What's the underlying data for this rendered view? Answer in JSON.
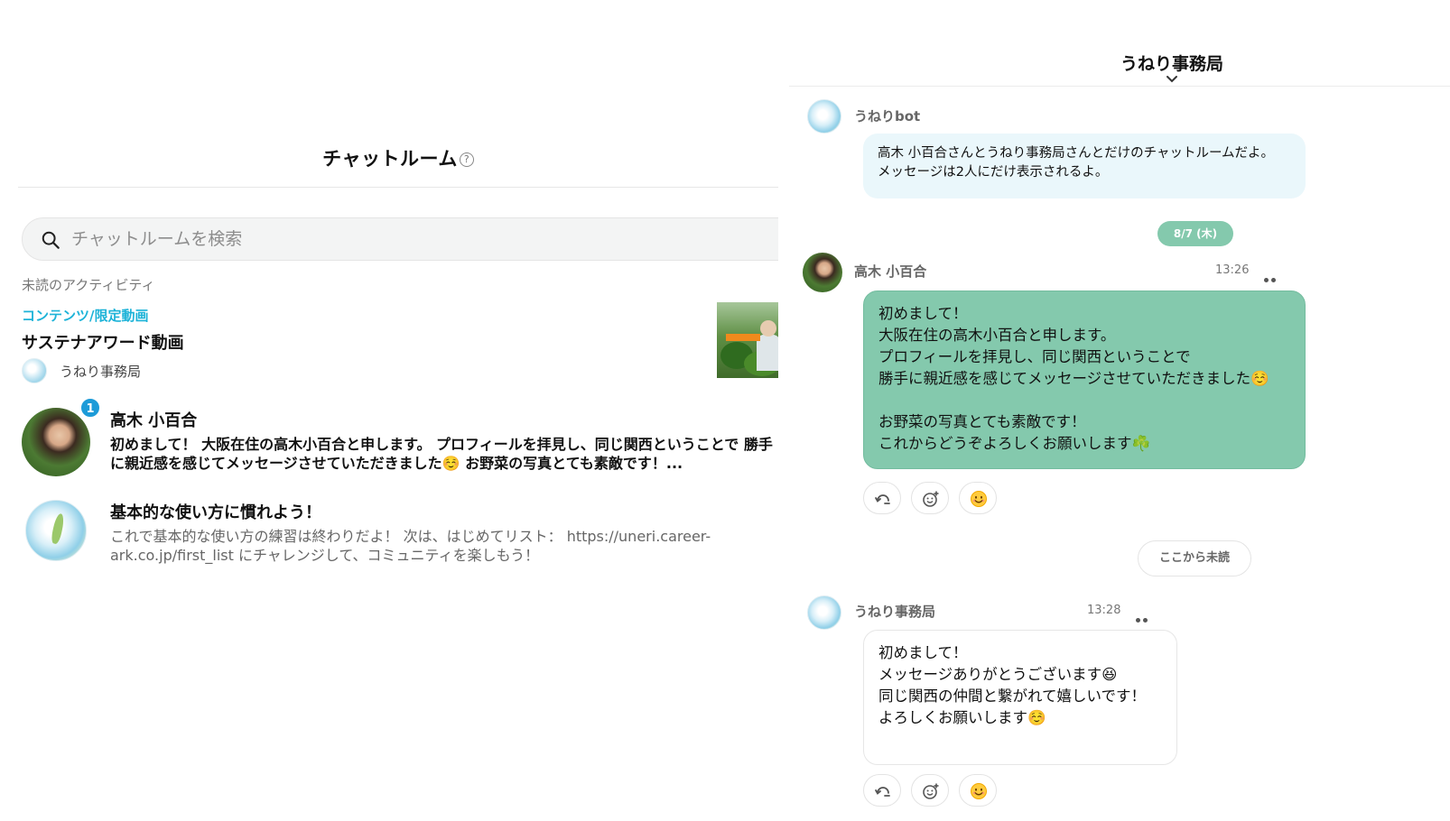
{
  "left": {
    "title": "チャットルーム",
    "help_glyph": "?",
    "search": {
      "placeholder": "チャットルームを検索"
    },
    "unread_section_label": "未読のアクティビティ",
    "content_item": {
      "category": "コンテンツ/限定動画",
      "title": "サステナアワード動画",
      "source": "うねり事務局"
    },
    "chats": [
      {
        "name": "高木 小百合",
        "badge": "1",
        "preview": "初めまして！ 大阪在住の高木小百合と申します。 プロフィールを拝見し、同じ関西ということで 勝手に親近感を感じてメッセージさせていただきました☺️ お野菜の写真とても素敵です！..."
      },
      {
        "name": "基本的な使い方に慣れよう！",
        "preview": "これで基本的な使い方の練習は終わりだよ！ 次は、はじめてリスト： https://uneri.career-ark.co.jp/first_list にチャレンジして、コミュニティを楽しもう！"
      }
    ]
  },
  "right": {
    "room_title": "うねり事務局",
    "messages": [
      {
        "sender": "うねりbot",
        "text": "高木 小百合さんとうねり事務局さんとだけのチャットルームだよ。\nメッセージは2人にだけ表示されるよ。"
      },
      {
        "sender": "高木 小百合",
        "time": "13:26",
        "text": "初めまして！\n大阪在住の高木小百合と申します。\nプロフィールを拝見し、同じ関西ということで\n勝手に親近感を感じてメッセージさせていただきました☺️\n\nお野菜の写真とても素敵です！\nこれからどうぞよろしくお願いします☘️"
      },
      {
        "sender": "うねり事務局",
        "time": "13:28",
        "text": "初めまして！\nメッセージありがとうございます😆\n同じ関西の仲間と繋がれて嬉しいです！\nよろしくお願いします☺️"
      }
    ],
    "date_divider": "8/7 (木)",
    "unread_divider": "ここから未読",
    "reaction_emoji": "😊"
  },
  "colors": {
    "accent_green": "#84c9ad",
    "link_cyan": "#1db3d8",
    "badge_blue": "#1d9bd8",
    "bot_bubble_bg": "#eaf7fb"
  },
  "icons": [
    "help-icon",
    "search-icon",
    "chevron-down-icon",
    "more-icon",
    "reply-icon",
    "add-reaction-icon",
    "smile-emoji-icon"
  ]
}
